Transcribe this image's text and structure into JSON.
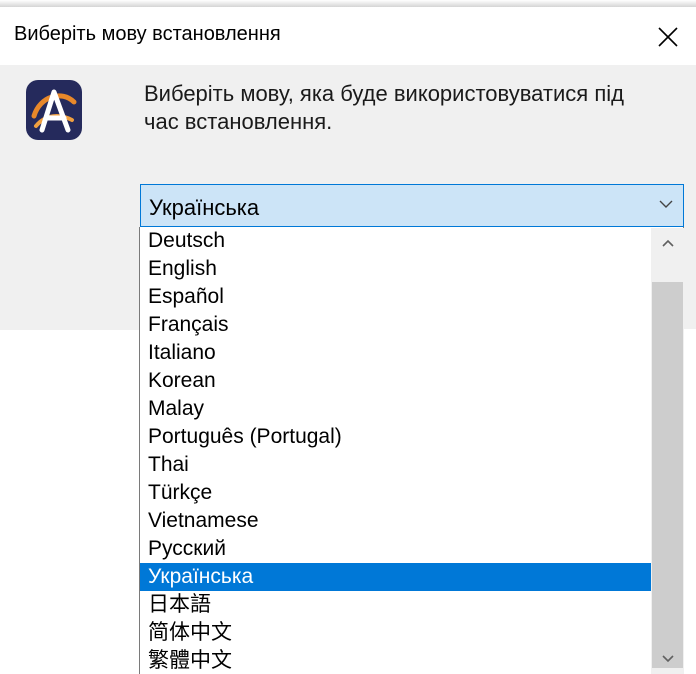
{
  "window": {
    "title": "Виберіть мову встановлення",
    "close_icon": "close-icon"
  },
  "app_icon": "installer-logo-icon",
  "prompt": {
    "line1": "Виберіть мову, яка буде використовуватися під",
    "line2": "час встановлення."
  },
  "combo": {
    "value": "Українська",
    "arrow_icon": "chevron-down-icon"
  },
  "dropdown": {
    "items": [
      "Deutsch",
      "English",
      "Español",
      "Français",
      "Italiano",
      "Korean",
      "Malay",
      "Português (Portugal)",
      "Thai",
      "Türkçe",
      "Vietnamese",
      "Русский",
      "Українська",
      "日本語",
      "简体中文",
      "繁體中文"
    ],
    "selected": "Українська",
    "scroll_up_icon": "scroll-up-arrow-icon",
    "scroll_down_icon": "scroll-down-arrow-icon"
  },
  "colors": {
    "accent": "#0078d7",
    "combo_bg": "#cce4f7",
    "dialog_bg": "#f0f0f0",
    "scroll_thumb": "#cdcdcd"
  }
}
